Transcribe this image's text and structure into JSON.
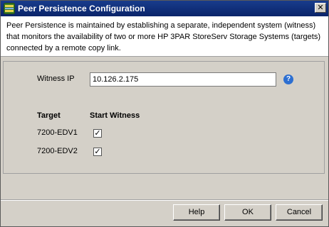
{
  "window": {
    "title": "Peer Persistence Configuration",
    "close_label": "✕"
  },
  "description": "Peer Persistence is maintained by establishing a separate, independent system (witness) that monitors the availability of two or more HP 3PAR StoreServ Storage Systems (targets) connected by a remote copy link.",
  "witness": {
    "label": "Witness IP",
    "value": "10.126.2.175",
    "help_label": "?"
  },
  "table": {
    "target_header": "Target",
    "start_header": "Start Witness",
    "rows": [
      {
        "target": "7200-EDV1",
        "checked": true
      },
      {
        "target": "7200-EDV2",
        "checked": true
      }
    ]
  },
  "buttons": {
    "help": "Help",
    "ok": "OK",
    "cancel": "Cancel"
  },
  "icons": {
    "app": "hp-3par-icon",
    "help": "help-icon",
    "close": "close-icon"
  }
}
